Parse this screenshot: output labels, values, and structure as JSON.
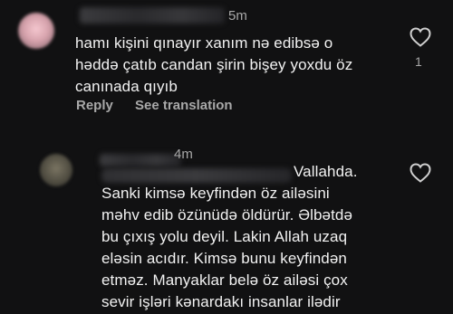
{
  "comments": [
    {
      "time": "5m",
      "text": "hamı kişini qınayır xanım nə edibsə o\nhəddə çatıb candan şirin bişey yoxdu öz\ncanınada qıyıb",
      "actions": {
        "reply": "Reply",
        "translate": "See translation"
      },
      "likes": "1"
    },
    {
      "time": "4m",
      "text_first": "Vallahda.",
      "text_rest": "Sanki kimsə keyfindən öz ailəsini\nməhv edib özünüdə öldürür. Əlbətdə\nbu çıxış yolu deyil. Lakin Allah uzaq\neləsin acıdır. Kimsə bunu keyfindən\netməz. Manyaklar belə öz ailəsi çox\nsevir işləri kənardakı insanlar ilədir"
    }
  ]
}
